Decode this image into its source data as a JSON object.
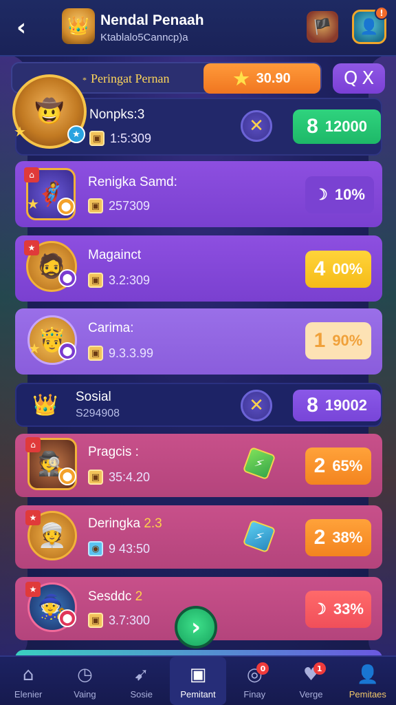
{
  "header": {
    "back_glyph": "‹",
    "title": "Nendal Penaah",
    "subtitle": "Ktablalo5Canncp)a",
    "notif_badge": "!"
  },
  "top_bar": {
    "prefix": "*",
    "label": "Peringat Pernan",
    "score": "30.90",
    "search_glyph": "Q",
    "close_glyph": "X"
  },
  "featured": {
    "name": "Nonpks:3",
    "score": "1:5:309",
    "stat": "12000",
    "stat_prefix": "8"
  },
  "players_a": [
    {
      "name": "Renigka Samd:",
      "score": "257309",
      "stat_prefix": "",
      "stat": "10%",
      "moon": true
    },
    {
      "name": "Magainct",
      "score": "3.2:309",
      "stat_prefix": "4",
      "stat": "00%"
    },
    {
      "name": "Carima:",
      "score": "9.3.3.99",
      "stat_prefix": "1",
      "stat": "90%"
    }
  ],
  "social": {
    "name": "Sosial",
    "sub": "S294908",
    "stat_prefix": "8",
    "stat": "19002"
  },
  "players_b": [
    {
      "name": "Pragcis :",
      "score": "35:4.20",
      "stat_prefix": "2",
      "stat": "65%"
    },
    {
      "name": "Deringka",
      "name_suffix": "2.3",
      "score": "9 43:50",
      "stat_prefix": "2",
      "stat": "38%"
    },
    {
      "name": "Sesddc",
      "name_suffix": "2",
      "score": "3.7:300",
      "stat_prefix": "",
      "stat": "33%"
    }
  ],
  "next_glyph": "›",
  "nav": [
    {
      "label": "Elenier",
      "icon": "home-icon"
    },
    {
      "label": "Vaing",
      "icon": "timer-icon"
    },
    {
      "label": "Sosie",
      "icon": "send-icon"
    },
    {
      "label": "Pemitant",
      "icon": "image-icon",
      "active": true
    },
    {
      "label": "Finay",
      "icon": "gamepad-icon",
      "badge": "0"
    },
    {
      "label": "Verge",
      "icon": "heart-icon",
      "badge": "1"
    },
    {
      "label": "Pemitaes",
      "icon": "user-icon"
    }
  ]
}
